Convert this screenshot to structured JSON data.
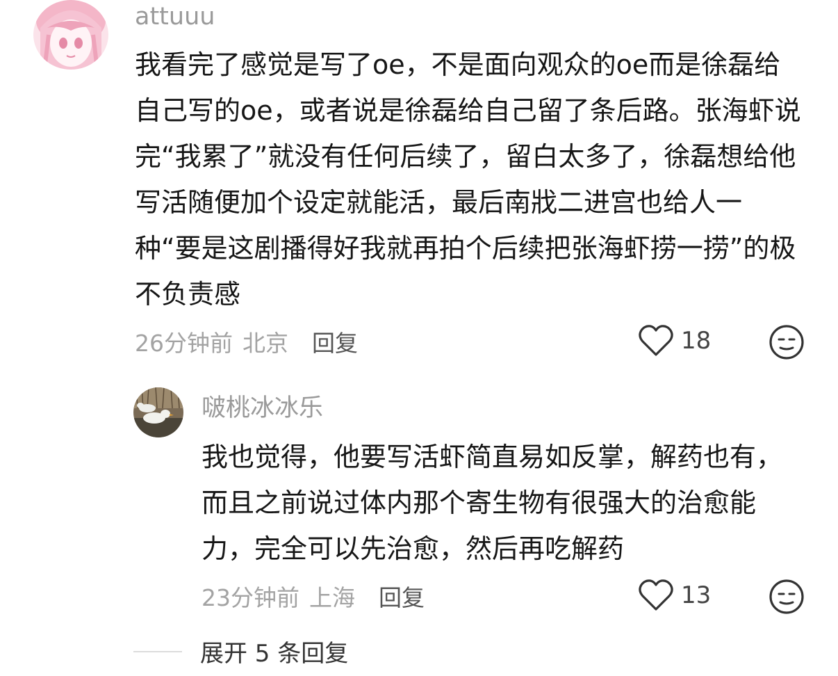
{
  "comment": {
    "username": "attuuu",
    "text": "我看完了感觉是写了oe，不是面向观众的oe而是徐磊给自己写的oe，或者说是徐磊给自己留了条后路。张海虾说完“我累了”就没有任何后续了，留白太多了，徐磊想给他写活随便加个设定就能活，最后南戕二进宫也给人一种“要是这剧播得好我就再拍个后续把张海虾捞一捞”的极不负责感",
    "time": "26分钟前",
    "location": "北京",
    "reply_label": "回复",
    "likes": "18",
    "avatar_icon": "anime-girl-avatar"
  },
  "reply": {
    "username": "啵桃冰冰乐",
    "text": "我也觉得，他要写活虾简直易如反掌，解药也有，而且之前说过体内那个寄生物有很强大的治愈能力，完全可以先治愈，然后再吃解药",
    "time": "23分钟前",
    "location": "上海",
    "reply_label": "回复",
    "likes": "13",
    "avatar_icon": "ducks-avatar"
  },
  "expand_replies_label": "展开 5 条回复",
  "icons": {
    "like": "heart-outline-icon",
    "reaction": "meh-face-icon"
  },
  "colors": {
    "username": "#9a9a9a",
    "meta": "#a3a3a3",
    "text": "#161616"
  }
}
